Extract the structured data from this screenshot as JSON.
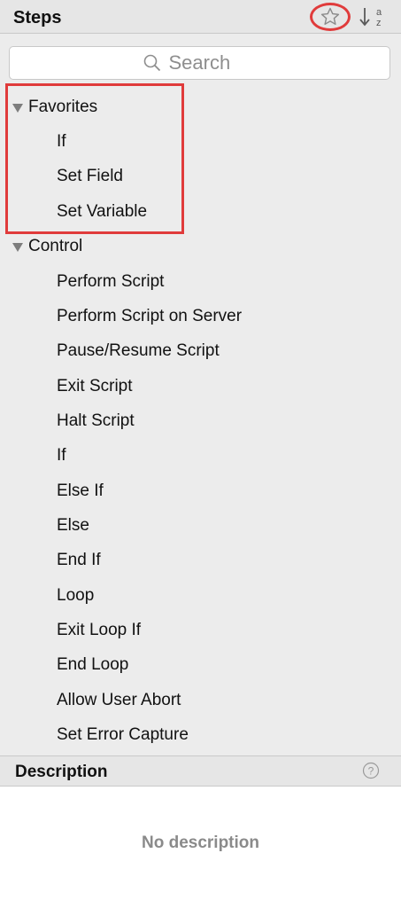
{
  "header": {
    "title": "Steps",
    "favorite_icon": "star-icon",
    "sort_icon": "sort-alpha-icon",
    "accent_color": "#e03b3b"
  },
  "search": {
    "placeholder": "Search",
    "value": ""
  },
  "groups": [
    {
      "label": "Favorites",
      "expanded": true,
      "items": [
        "If",
        "Set Field",
        "Set Variable"
      ]
    },
    {
      "label": "Control",
      "expanded": true,
      "items": [
        "Perform Script",
        "Perform Script on Server",
        "Pause/Resume Script",
        "Exit Script",
        "Halt Script",
        "If",
        "Else If",
        "Else",
        "End If",
        "Loop",
        "Exit Loop If",
        "End Loop",
        "Allow User Abort",
        "Set Error Capture"
      ]
    }
  ],
  "description": {
    "title": "Description",
    "help_icon": "help-icon",
    "text": "No description"
  }
}
